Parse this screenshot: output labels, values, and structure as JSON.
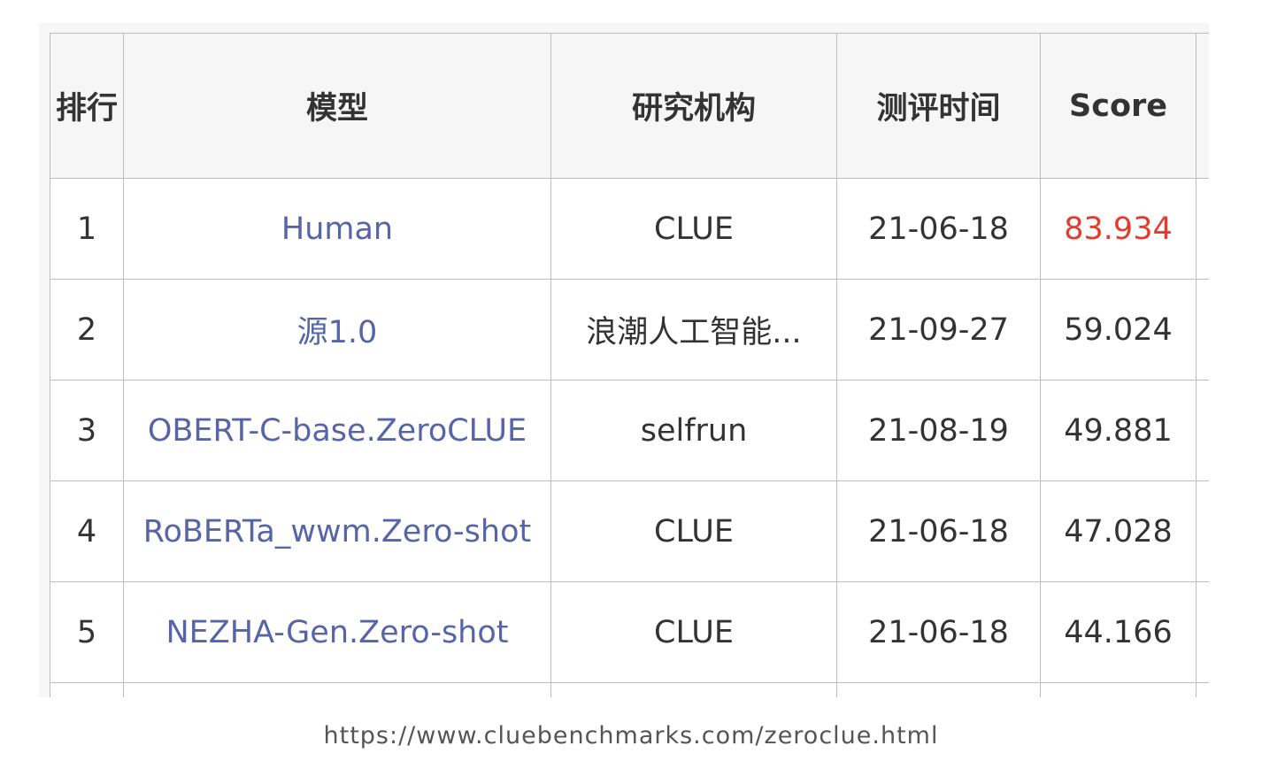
{
  "table": {
    "headers": {
      "rank": "排行",
      "model": "模型",
      "org": "研究机构",
      "date": "测评时间",
      "score": "Score"
    },
    "rows": [
      {
        "rank": "1",
        "model": "Human",
        "org": "CLUE",
        "date": "21-06-18",
        "score": "83.934"
      },
      {
        "rank": "2",
        "model": "源1.0",
        "org": "浪潮人工智能...",
        "date": "21-09-27",
        "score": "59.024"
      },
      {
        "rank": "3",
        "model": "OBERT-C-base.ZeroCLUE",
        "org": "selfrun",
        "date": "21-08-19",
        "score": "49.881"
      },
      {
        "rank": "4",
        "model": "RoBERTa_wwm.Zero-shot",
        "org": "CLUE",
        "date": "21-06-18",
        "score": "47.028"
      },
      {
        "rank": "5",
        "model": "NEZHA-Gen.Zero-shot",
        "org": "CLUE",
        "date": "21-06-18",
        "score": "44.166"
      }
    ]
  },
  "colors": {
    "model_link": "#5664a8",
    "top_score": "#e33b2e",
    "header_bg": "#f6f6f6",
    "border": "#bdbdbd"
  },
  "caption": {
    "url": "https://www.cluebenchmarks.com/zeroclue.html"
  }
}
